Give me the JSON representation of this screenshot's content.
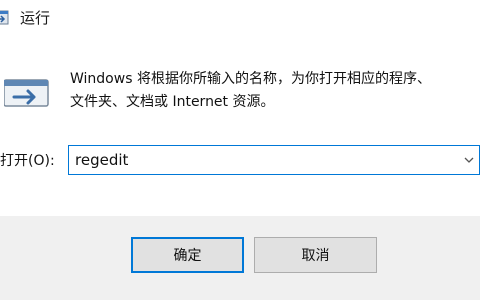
{
  "window": {
    "title": "运行",
    "title_icon": "run-dialog-icon"
  },
  "body": {
    "icon": "run-program-icon",
    "description_line1": "Windows 将根据你所输入的名称，为你打开相应的程序、",
    "description_line2": "文件夹、文档或 Internet 资源。",
    "open_label": "打开(O):",
    "open_value": "regedit",
    "dropdown_icon": "chevron-down-icon"
  },
  "buttons": {
    "ok_label": "确定",
    "cancel_label": "取消"
  },
  "colors": {
    "accent": "#0078d7",
    "footer_bg": "#f0f0f0",
    "button_bg": "#e1e1e1"
  }
}
